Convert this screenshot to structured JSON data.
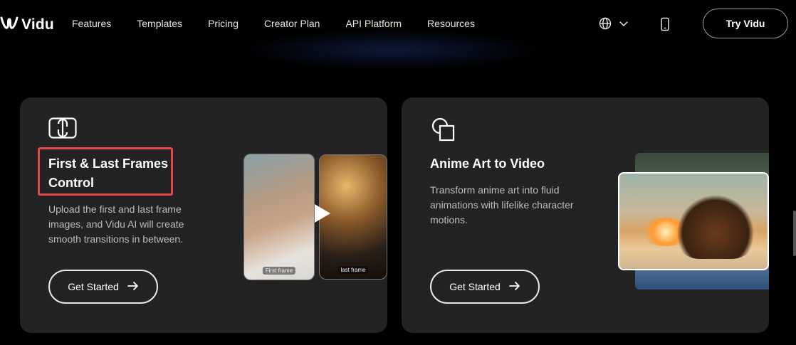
{
  "brand": {
    "name": "Vidu",
    "logo_icon": "vidu-logo-icon"
  },
  "nav": {
    "items": [
      "Features",
      "Templates",
      "Pricing",
      "Creator Plan",
      "API Platform",
      "Resources"
    ],
    "language_icon": "globe-icon",
    "dropdown_icon": "chevron-down-icon",
    "mobile_icon": "phone-icon",
    "cta_label": "Try Vidu"
  },
  "cards": [
    {
      "icon": "frames-control-icon",
      "title": "First & Last Frames Control",
      "description": "Upload the first and last frame images, and Vidu AI will create smooth transitions in between.",
      "button_label": "Get Started",
      "frame_labels": [
        "First frame",
        "last frame"
      ],
      "highlighted": true
    },
    {
      "icon": "shapes-icon",
      "title": "Anime Art to Video",
      "description": "Transform anime art into fluid animations with lifelike character motions.",
      "button_label": "Get Started"
    }
  ],
  "colors": {
    "card_bg": "#232323",
    "highlight": "#e5484d",
    "page_bg": "#000000"
  }
}
